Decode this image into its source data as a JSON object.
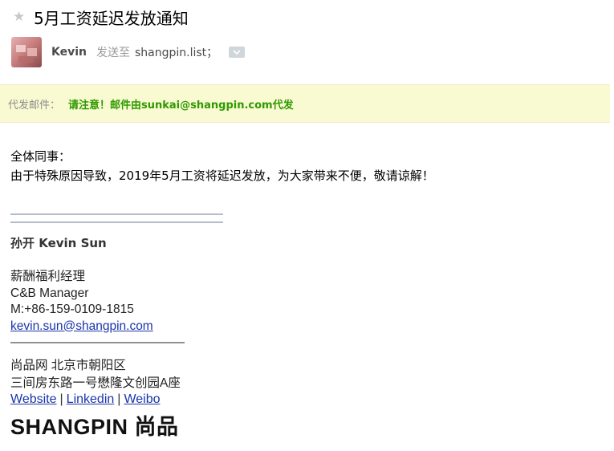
{
  "subject": {
    "star_icon": "star-icon",
    "title": "5月工资延迟发放通知"
  },
  "sender": {
    "name": "Kevin",
    "sent_to_label": "发送至",
    "recipients": "shangpin.list；",
    "expand_icon": "chevron-down-icon"
  },
  "proxy": {
    "label": "代发邮件：",
    "notice": "请注意！邮件由sunkai@shangpin.com代发"
  },
  "body": {
    "greeting": "全体同事：",
    "message": "由于特殊原因导致，2019年5月工资将延迟发放，为大家带来不便，敬请谅解！"
  },
  "signature": {
    "name": "孙开 Kevin Sun",
    "title_cn": "薪酬福利经理",
    "title_en": "C&B Manager",
    "mobile": "M:+86-159-0109-1815",
    "email": "kevin.sun@shangpin.com",
    "divider": "——————————————",
    "company_city": "尚品网 北京市朝阳区",
    "address": "三间房东路一号懋隆文创园A座",
    "links": [
      "Website",
      "Linkedin",
      "Weibo"
    ],
    "separator": "|",
    "logo": "SHANGPIN 尚品"
  },
  "colors": {
    "proxy_background": "#fafad2",
    "proxy_notice": "#2e9a00",
    "link": "#1a35aa",
    "signature_rule": "#b4bccb"
  }
}
